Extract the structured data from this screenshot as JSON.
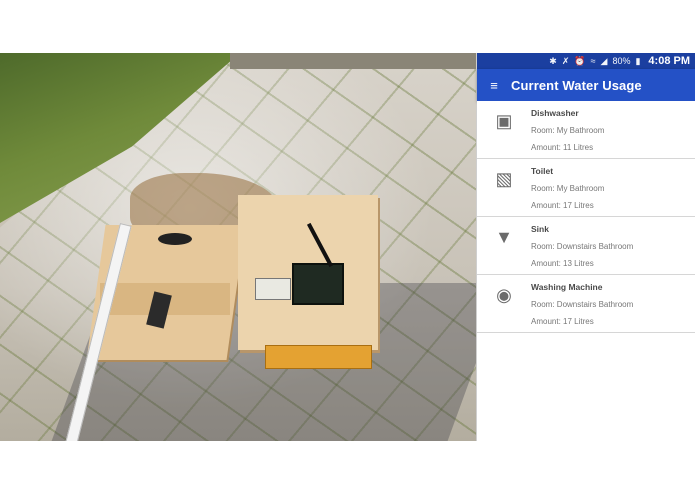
{
  "status_bar": {
    "icons": [
      "bluetooth-icon",
      "mute-icon",
      "alarm-icon",
      "wifi-icon",
      "signal-icon",
      "battery-icon"
    ],
    "battery": "80%",
    "time": "4:08 PM"
  },
  "app_bar": {
    "title": "Current Water Usage",
    "menu_icon": "menu-icon"
  },
  "appliances": [
    {
      "name": "Dishwasher",
      "room": "Room: My Bathroom",
      "amount": "Amount: 11 Litres",
      "icon": "dishwasher-icon"
    },
    {
      "name": "Toilet",
      "room": "Room: My Bathroom",
      "amount": "Amount: 17 Litres",
      "icon": "toilet-icon"
    },
    {
      "name": "Sink",
      "room": "Room: Downstairs Bathroom",
      "amount": "Amount: 13 Litres",
      "icon": "faucet-icon"
    },
    {
      "name": "Washing Machine",
      "room": "Room: Downstairs Bathroom",
      "amount": "Amount: 17 Litres",
      "icon": "washing-machine-icon"
    }
  ],
  "colors": {
    "status_bar": "#1b3fa0",
    "app_bar": "#2451c6"
  }
}
